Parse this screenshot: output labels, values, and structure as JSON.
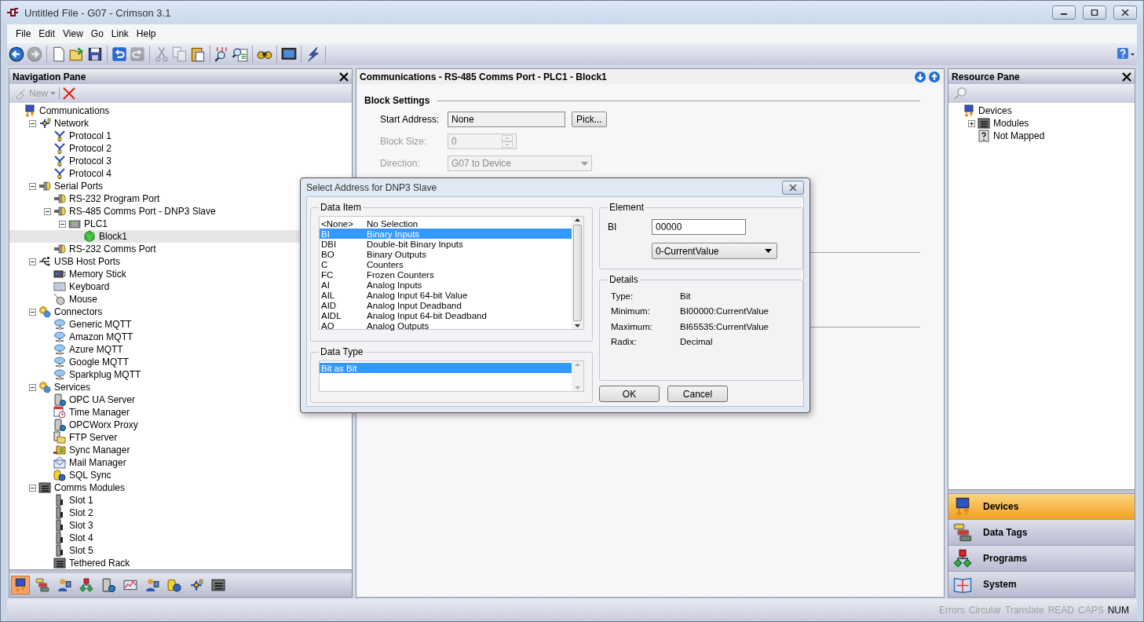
{
  "window": {
    "title": "Untitled File - G07 - Crimson 3.1"
  },
  "menu": [
    "File",
    "Edit",
    "View",
    "Go",
    "Link",
    "Help"
  ],
  "toolbar": [
    {
      "kind": "back",
      "disabled": false
    },
    {
      "kind": "forward",
      "disabled": true
    },
    {
      "kind": "separator"
    },
    {
      "kind": "new",
      "disabled": false
    },
    {
      "kind": "open",
      "disabled": false
    },
    {
      "kind": "save",
      "disabled": false
    },
    {
      "kind": "separator"
    },
    {
      "kind": "undo",
      "disabled": false
    },
    {
      "kind": "redo",
      "disabled": true
    },
    {
      "kind": "separator"
    },
    {
      "kind": "cut",
      "disabled": true
    },
    {
      "kind": "copy",
      "disabled": true
    },
    {
      "kind": "paste",
      "disabled": false
    },
    {
      "kind": "separator"
    },
    {
      "kind": "findall",
      "disabled": false
    },
    {
      "kind": "find",
      "disabled": false
    },
    {
      "kind": "separator"
    },
    {
      "kind": "binoculars",
      "disabled": false
    },
    {
      "kind": "separator"
    },
    {
      "kind": "screen",
      "disabled": false
    },
    {
      "kind": "separator"
    },
    {
      "kind": "lightning",
      "disabled": false
    },
    {
      "kind": "separator"
    }
  ],
  "navigation": {
    "title": "Navigation Pane",
    "new_button": {
      "label": "New",
      "disabled": true
    },
    "tree": [
      {
        "label": "Communications",
        "kind": "comms",
        "selected": false,
        "children": [
          {
            "label": "Network",
            "kind": "network",
            "expanded": true,
            "selected": false,
            "children": [
              {
                "label": "Protocol 1",
                "kind": "protocol",
                "selected": false
              },
              {
                "label": "Protocol 2",
                "kind": "protocol",
                "selected": false
              },
              {
                "label": "Protocol 3",
                "kind": "protocol",
                "selected": false
              },
              {
                "label": "Protocol 4",
                "kind": "protocol",
                "selected": false
              }
            ]
          },
          {
            "label": "Serial Ports",
            "kind": "serial",
            "expanded": true,
            "selected": false,
            "children": [
              {
                "label": "RS-232 Program Port",
                "kind": "port",
                "selected": false
              },
              {
                "label": "RS-485 Comms Port - DNP3 Slave",
                "kind": "port",
                "expanded": true,
                "selected": false,
                "children": [
                  {
                    "label": "PLC1",
                    "kind": "plc",
                    "expanded": true,
                    "selected": false,
                    "children": [
                      {
                        "label": "Block1",
                        "kind": "block",
                        "selected": true
                      }
                    ]
                  }
                ]
              },
              {
                "label": "RS-232 Comms Port",
                "kind": "port",
                "selected": false
              }
            ]
          },
          {
            "label": "USB Host Ports",
            "kind": "usb",
            "expanded": true,
            "selected": false,
            "children": [
              {
                "label": "Memory Stick",
                "kind": "stick",
                "selected": false
              },
              {
                "label": "Keyboard",
                "kind": "keyboard",
                "selected": false
              },
              {
                "label": "Mouse",
                "kind": "mouse",
                "selected": false
              }
            ]
          },
          {
            "label": "Connectors",
            "kind": "gears",
            "expanded": true,
            "selected": false,
            "children": [
              {
                "label": "Generic MQTT",
                "kind": "cloud",
                "selected": false
              },
              {
                "label": "Amazon MQTT",
                "kind": "cloud",
                "selected": false
              },
              {
                "label": "Azure MQTT",
                "kind": "cloud",
                "selected": false
              },
              {
                "label": "Google MQTT",
                "kind": "cloud",
                "selected": false
              },
              {
                "label": "Sparkplug MQTT",
                "kind": "cloud",
                "selected": false
              }
            ]
          },
          {
            "label": "Services",
            "kind": "gears",
            "expanded": true,
            "selected": false,
            "children": [
              {
                "label": "OPC UA Server",
                "kind": "server",
                "selected": false
              },
              {
                "label": "Time Manager",
                "kind": "calendar",
                "selected": false
              },
              {
                "label": "OPCWorx Proxy",
                "kind": "server",
                "selected": false
              },
              {
                "label": "FTP Server",
                "kind": "folder",
                "selected": false
              },
              {
                "label": "Sync Manager",
                "kind": "sync",
                "selected": false
              },
              {
                "label": "Mail Manager",
                "kind": "mail",
                "selected": false
              },
              {
                "label": "SQL Sync",
                "kind": "database",
                "selected": false
              }
            ]
          },
          {
            "label": "Comms Modules",
            "kind": "rack",
            "expanded": true,
            "selected": false,
            "children": [
              {
                "label": "Slot 1",
                "kind": "slot",
                "selected": false
              },
              {
                "label": "Slot 2",
                "kind": "slot",
                "selected": false
              },
              {
                "label": "Slot 3",
                "kind": "slot",
                "selected": false
              },
              {
                "label": "Slot 4",
                "kind": "slot",
                "selected": false
              },
              {
                "label": "Slot 5",
                "kind": "slot",
                "selected": false
              },
              {
                "label": "Tethered Rack",
                "kind": "rack",
                "selected": false
              }
            ]
          }
        ]
      }
    ],
    "bottom_buttons": [
      {
        "kind": "comms",
        "selected": true
      },
      {
        "kind": "tags",
        "selected": false
      },
      {
        "kind": "user",
        "selected": false
      },
      {
        "kind": "flow",
        "selected": false
      },
      {
        "kind": "server",
        "selected": false
      },
      {
        "kind": "chart",
        "selected": false
      },
      {
        "kind": "user",
        "selected": false
      },
      {
        "kind": "database",
        "selected": false
      },
      {
        "kind": "network",
        "selected": false
      },
      {
        "kind": "rack",
        "selected": false
      }
    ]
  },
  "editor": {
    "title": "Communications - RS-485 Comms Port - PLC1 - Block1",
    "section": "Block Settings",
    "fields": [
      {
        "label": "Start Address:",
        "value": "None",
        "kind": "pick",
        "button": "Pick...",
        "disabled": false
      },
      {
        "label": "Block Size:",
        "value": "0",
        "kind": "spin",
        "disabled": true
      },
      {
        "label": "Direction:",
        "value": "G07 to Device",
        "kind": "dropdown",
        "disabled": true
      }
    ]
  },
  "resource": {
    "title": "Resource Pane",
    "tree": [
      {
        "label": "Devices",
        "kind": "comms",
        "children": [
          {
            "label": "Modules",
            "kind": "rack",
            "expanded": false
          },
          {
            "label": "Not Mapped",
            "kind": "question"
          }
        ]
      }
    ],
    "categories": [
      {
        "label": "Devices",
        "kind": "comms",
        "selected": true
      },
      {
        "label": "Data Tags",
        "kind": "tags",
        "selected": false
      },
      {
        "label": "Programs",
        "kind": "flow",
        "selected": false
      },
      {
        "label": "System",
        "kind": "book",
        "selected": false
      }
    ]
  },
  "dialog": {
    "title": "Select Address for DNP3 Slave",
    "data_item": {
      "legend": "Data Item",
      "items": [
        {
          "code": "<None>",
          "name": "No Selection",
          "selected": false
        },
        {
          "code": "BI",
          "name": "Binary Inputs",
          "selected": true
        },
        {
          "code": "DBI",
          "name": "Double-bit Binary Inputs",
          "selected": false
        },
        {
          "code": "BO",
          "name": "Binary Outputs",
          "selected": false
        },
        {
          "code": "C",
          "name": "Counters",
          "selected": false
        },
        {
          "code": "FC",
          "name": "Frozen Counters",
          "selected": false
        },
        {
          "code": "AI",
          "name": "Analog Inputs",
          "selected": false
        },
        {
          "code": "AIL",
          "name": "Analog Input 64-bit Value",
          "selected": false
        },
        {
          "code": "AID",
          "name": "Analog Input Deadband",
          "selected": false
        },
        {
          "code": "AIDL",
          "name": "Analog Input 64-bit Deadband",
          "selected": false
        },
        {
          "code": "AO",
          "name": "Analog Outputs",
          "selected": false
        }
      ]
    },
    "data_type": {
      "legend": "Data Type",
      "items": [
        {
          "label": "Bit as Bit",
          "selected": true
        }
      ]
    },
    "element": {
      "legend": "Element",
      "label": "BI",
      "value": "00000",
      "dropdown": "0-CurrentValue"
    },
    "details": {
      "legend": "Details",
      "rows": [
        {
          "label": "Type:",
          "value": "Bit"
        },
        {
          "label": "Minimum:",
          "value": "BI00000:CurrentValue"
        },
        {
          "label": "Maximum:",
          "value": "BI65535:CurrentValue"
        },
        {
          "label": "Radix:",
          "value": "Decimal"
        }
      ]
    },
    "buttons": [
      "OK",
      "Cancel"
    ]
  },
  "status_bar": [
    {
      "label": "Errors",
      "on": false
    },
    {
      "label": "Circular",
      "on": false
    },
    {
      "label": "Translate",
      "on": false
    },
    {
      "label": "READ",
      "on": false
    },
    {
      "label": "CAPS",
      "on": false
    },
    {
      "label": "NUM",
      "on": true
    }
  ]
}
